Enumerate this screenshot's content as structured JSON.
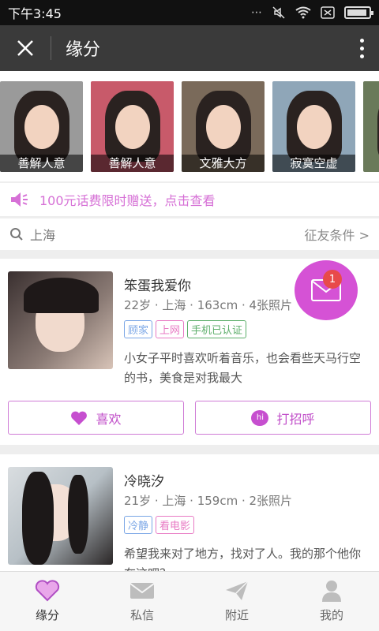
{
  "status_bar": {
    "time": "下午3:45"
  },
  "titlebar": {
    "title": "缘分"
  },
  "featured": [
    {
      "label": "善解人意"
    },
    {
      "label": "善解人意"
    },
    {
      "label": "文雅大方"
    },
    {
      "label": "寂寞空虚"
    }
  ],
  "promo": {
    "text": "100元话费限时赠送，点击查看"
  },
  "search": {
    "city": "上海",
    "filter": "征友条件 >"
  },
  "cards": [
    {
      "name": "笨蛋我爱你",
      "meta": "22岁 · 上海 · 163cm · 4张照片",
      "tags": [
        "顾家",
        "上网",
        "手机已认证"
      ],
      "desc": "小女子平时喜欢听着音乐，也会看些天马行空的书，美食是对我最大",
      "like_label": "喜欢",
      "greet_label": "打招呼"
    },
    {
      "name": "冷晓汐",
      "meta": "21岁 · 上海 · 159cm · 2张照片",
      "tags": [
        "冷静",
        "看电影"
      ],
      "desc": "希望我来对了地方，找对了人。我的那个他你在这吧？"
    }
  ],
  "fab": {
    "badge": "1"
  },
  "bottom_nav": [
    {
      "label": "缘分"
    },
    {
      "label": "私信"
    },
    {
      "label": "附近"
    },
    {
      "label": "我的"
    }
  ],
  "colors": {
    "accent": "#d552d5",
    "title_bar": "#3a3a3a"
  }
}
